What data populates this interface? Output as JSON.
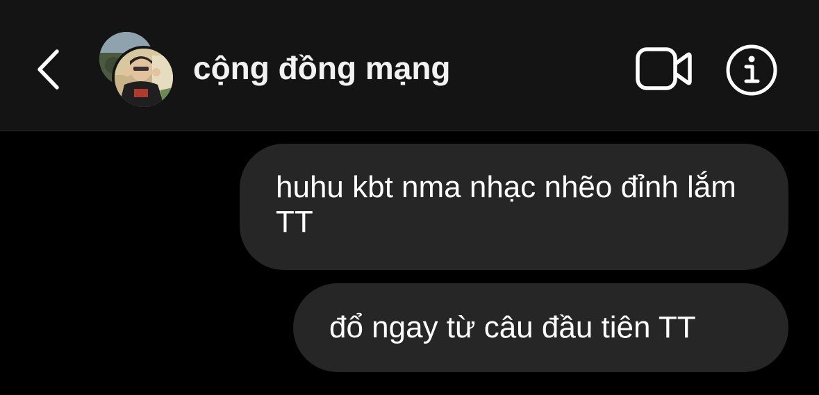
{
  "header": {
    "contact_name": "cộng đồng mạng",
    "back_icon": "chevron-left-icon",
    "video_icon": "video-camera-icon",
    "info_icon": "info-icon"
  },
  "messages": [
    {
      "text": "huhu kbt nma nhạc nhẽo đỉnh lắm TT",
      "sender": "me"
    },
    {
      "text": "đổ ngay từ câu đầu tiên TT",
      "sender": "me"
    }
  ],
  "colors": {
    "background": "#000000",
    "header_background": "#141414",
    "bubble_background": "#262626",
    "text": "#ffffff"
  }
}
